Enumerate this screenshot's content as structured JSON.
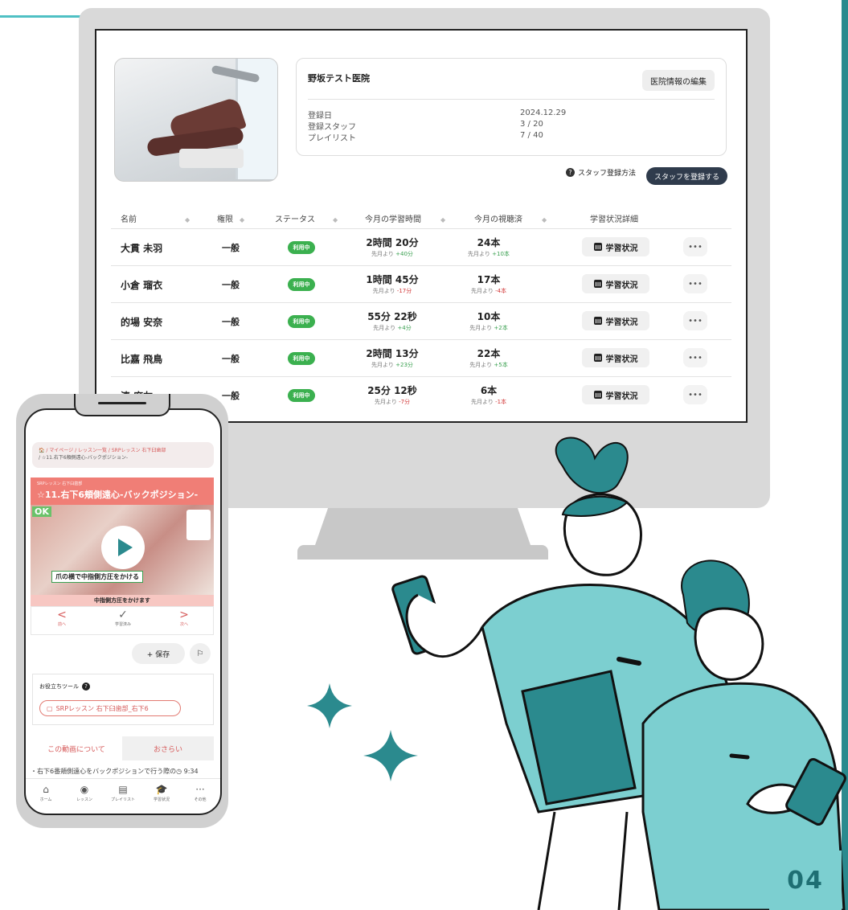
{
  "page_number": "04",
  "dashboard": {
    "clinic_name": "野坂テスト医院",
    "edit_button": "医院情報の編集",
    "info": [
      {
        "label": "登録日",
        "value": "2024.12.29"
      },
      {
        "label": "登録スタッフ",
        "value": "3 / 20"
      },
      {
        "label": "プレイリスト",
        "value": "7 / 40"
      }
    ],
    "help_link": "スタッフ登録方法",
    "help_icon": "?",
    "register_button": "スタッフを登録する",
    "sort_glyph": "◆",
    "columns": [
      "名前",
      "権限",
      "ステータス",
      "今月の学習時間",
      "今月の視聴済",
      "学習状況詳細"
    ],
    "rows": [
      {
        "name": "大貫 未羽",
        "role": "一般",
        "status": "利用中",
        "time": "2時間 20分",
        "time_prefix": "先月より",
        "time_diff": "+40分",
        "time_diff_positive": true,
        "count": "24本",
        "count_prefix": "先月より",
        "count_diff": "+10本",
        "count_diff_positive": true,
        "detail": "学習状況",
        "more": "•••"
      },
      {
        "name": "小倉 瑠衣",
        "role": "一般",
        "status": "利用中",
        "time": "1時間 45分",
        "time_prefix": "先月より",
        "time_diff": "-17分",
        "time_diff_positive": false,
        "count": "17本",
        "count_prefix": "先月より",
        "count_diff": "-4本",
        "count_diff_positive": false,
        "detail": "学習状況",
        "more": "•••"
      },
      {
        "name": "的場 安奈",
        "role": "一般",
        "status": "利用中",
        "time": "55分 22秒",
        "time_prefix": "先月より",
        "time_diff": "+4分",
        "time_diff_positive": true,
        "count": "10本",
        "count_prefix": "先月より",
        "count_diff": "+2本",
        "count_diff_positive": true,
        "detail": "学習状況",
        "more": "•••"
      },
      {
        "name": "比嘉 飛鳥",
        "role": "一般",
        "status": "利用中",
        "time": "2時間 13分",
        "time_prefix": "先月より",
        "time_diff": "+23分",
        "time_diff_positive": true,
        "count": "22本",
        "count_prefix": "先月より",
        "count_diff": "+5本",
        "count_diff_positive": true,
        "detail": "学習状況",
        "more": "•••"
      },
      {
        "name": "湊 麻友",
        "role": "一般",
        "status": "利用中",
        "time": "25分 12秒",
        "time_prefix": "先月より",
        "time_diff": "-7分",
        "time_diff_positive": false,
        "count": "6本",
        "count_prefix": "先月より",
        "count_diff": "-1本",
        "count_diff_positive": false,
        "detail": "学習状況",
        "more": "•••"
      }
    ]
  },
  "phone": {
    "breadcrumb_line1": "🏠 / マイページ / レッスン一覧 / SRPレッスン 右下臼歯部",
    "breadcrumb_line2": "/ ☆11.右下6頬側遠心-バックポジション-",
    "lesson_category": "SRPレッスン 右下臼歯部",
    "lesson_title": "☆11.右下6頬側遠心-バックポジション-",
    "video_ok": "OK",
    "video_caption": "爪の横で中指側方圧をかける",
    "video_subtitle": "中指側方圧をかけます",
    "nav": [
      {
        "glyph": "<",
        "label": "前へ"
      },
      {
        "glyph": "✓",
        "label": "学習済み"
      },
      {
        "glyph": ">",
        "label": "次へ"
      }
    ],
    "save_button": "+ 保存",
    "flag_glyph": "⚐",
    "tools_title": "お役立ちツール",
    "tools_help": "?",
    "tool_item": "SRPレッスン 右下臼歯部_右下6",
    "tab_about": "この動画について",
    "tab_review": "おさらい",
    "description": "・右下6番頬側遠心をバックポジションで行う際の◷ 9:34",
    "tabbar": [
      {
        "glyph": "⌂",
        "label": "ホーム"
      },
      {
        "glyph": "◉",
        "label": "レッスン"
      },
      {
        "glyph": "▤",
        "label": "プレイリスト"
      },
      {
        "glyph": "🎓",
        "label": "学習状況"
      },
      {
        "glyph": "···",
        "label": "その他"
      }
    ]
  },
  "colors": {
    "accent_teal": "#2b8a8e",
    "light_teal": "#7ccfd0",
    "status_green": "#3bb04f",
    "lesson_red": "#f07e76",
    "positive": "#3aa050",
    "negative": "#d23838"
  }
}
